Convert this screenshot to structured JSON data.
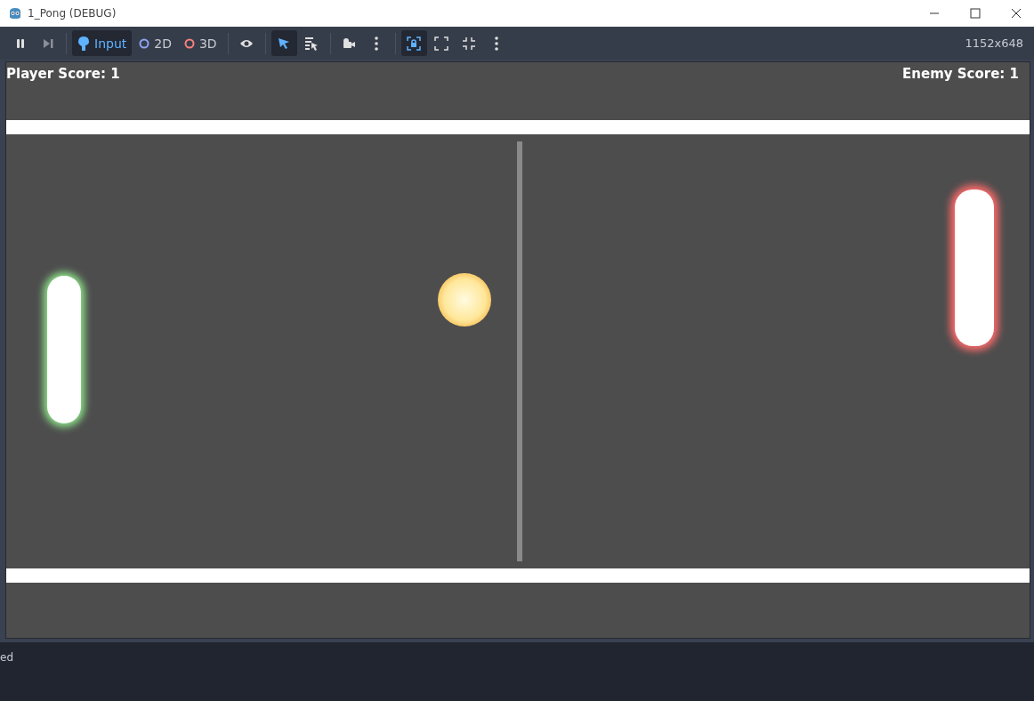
{
  "window": {
    "title": "1_Pong (DEBUG)"
  },
  "toolbar": [
    {
      "kind": "pause",
      "selected": false
    },
    {
      "kind": "step",
      "selected": false
    },
    {
      "kind": "input",
      "label": "Input",
      "selected": true
    },
    {
      "kind": "flat",
      "label": "2D",
      "selected": false
    },
    {
      "kind": "spatial",
      "label": "3D",
      "selected": false
    },
    {
      "kind": "eye",
      "selected": false
    },
    {
      "kind": "select",
      "selected": true
    },
    {
      "kind": "listpick",
      "selected": false
    },
    {
      "kind": "camera",
      "selected": false
    },
    {
      "kind": "more",
      "selected": false
    },
    {
      "kind": "lock",
      "selected": true
    },
    {
      "kind": "expand",
      "selected": false
    },
    {
      "kind": "shrink",
      "selected": false
    },
    {
      "kind": "more",
      "selected": false
    }
  ],
  "viewport_size": "1152x648",
  "game": {
    "player_score": "Player Score: 1",
    "enemy_score": "Enemy Score: 1"
  },
  "console": {
    "text": "ed"
  }
}
